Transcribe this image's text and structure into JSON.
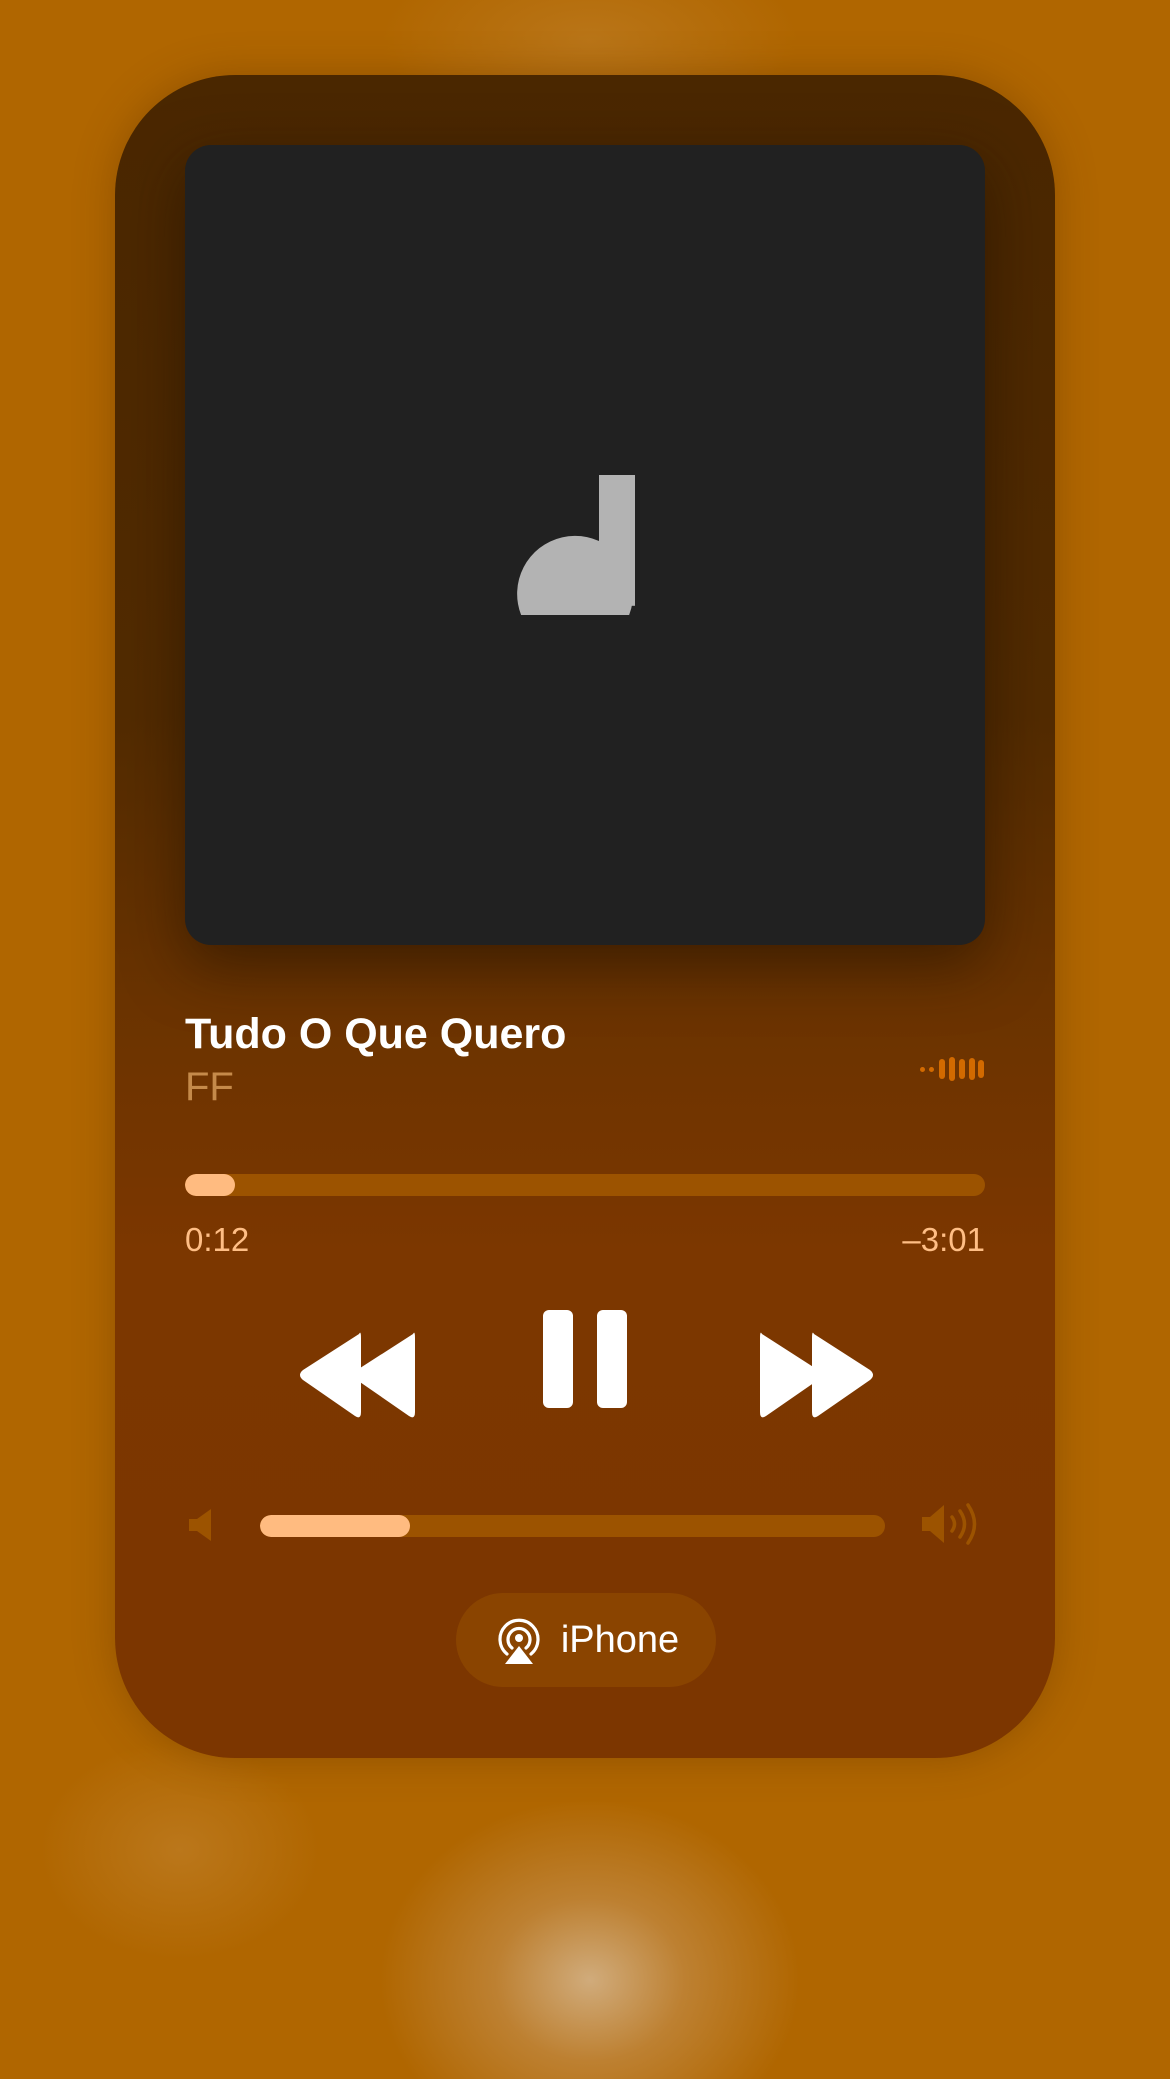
{
  "now_playing": {
    "title": "Tudo O Que Quero",
    "artist": "FF",
    "artwork_icon": "music-note-icon",
    "waveform_icon": "waveform-icon"
  },
  "playback": {
    "elapsed": "0:12",
    "remaining": "–3:01",
    "progress_percent": 6.3
  },
  "controls": {
    "rewind_icon": "rewind-icon",
    "pause_icon": "pause-icon",
    "forward_icon": "fast-forward-icon"
  },
  "volume": {
    "level_percent": 24,
    "low_icon": "speaker-low-icon",
    "high_icon": "speaker-high-icon"
  },
  "output": {
    "device": "iPhone",
    "icon": "airplay-icon"
  },
  "colors": {
    "background": "#b06600",
    "accent": "#ffbb80",
    "track": "#9c5300",
    "artist_text": "#c58a4a",
    "artwork_bg": "#212121"
  }
}
